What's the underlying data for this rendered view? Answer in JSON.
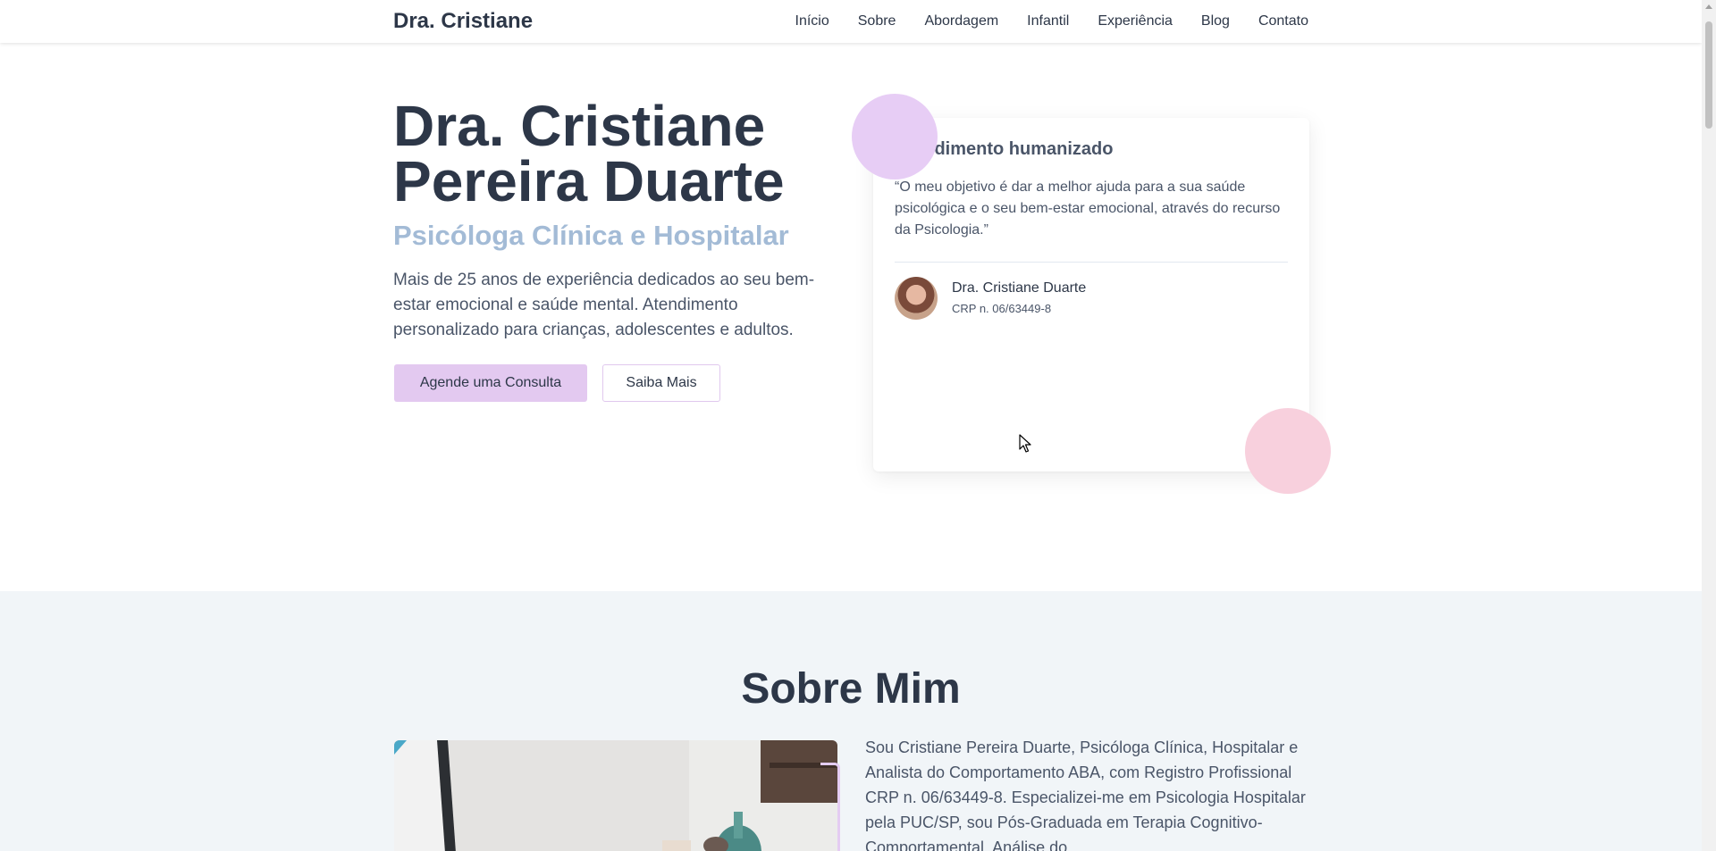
{
  "header": {
    "brand": "Dra. Cristiane",
    "nav": [
      "Início",
      "Sobre",
      "Abordagem",
      "Infantil",
      "Experiência",
      "Blog",
      "Contato"
    ]
  },
  "hero": {
    "title": "Dra. Cristiane Pereira Duarte",
    "subtitle": "Psicóloga Clínica e Hospitalar",
    "description": "Mais de 25 anos de experiência dedicados ao seu bem-estar emocional e saúde mental. Atendimento personalizado para crianças, adolescentes e adultos.",
    "primary_button": "Agende uma Consulta",
    "secondary_button": "Saiba Mais"
  },
  "card": {
    "title": "Atendimento humanizado",
    "quote": "“O meu objetivo é dar a melhor ajuda para a sua saúde psicológica e o seu bem-estar emocional, através do recurso da Psicologia.”",
    "author_name": "Dra. Cristiane Duarte",
    "author_crp": "CRP n. 06/63449-8"
  },
  "about": {
    "heading": "Sobre Mim",
    "text": "Sou Cristiane Pereira Duarte, Psicóloga Clínica, Hospitalar e Analista do Comportamento ABA, com Registro Profissional CRP n. 06/63449-8. Especializei-me em Psicologia Hospitalar pela PUC/SP, sou Pós-Graduada em Terapia Cognitivo-Comportamental, Análise do"
  },
  "colors": {
    "accent_purple": "#e3c9f0",
    "accent_pink": "#f8d0dd",
    "subtitle_blue": "#a3bbd6",
    "text_dark": "#2d3748"
  }
}
